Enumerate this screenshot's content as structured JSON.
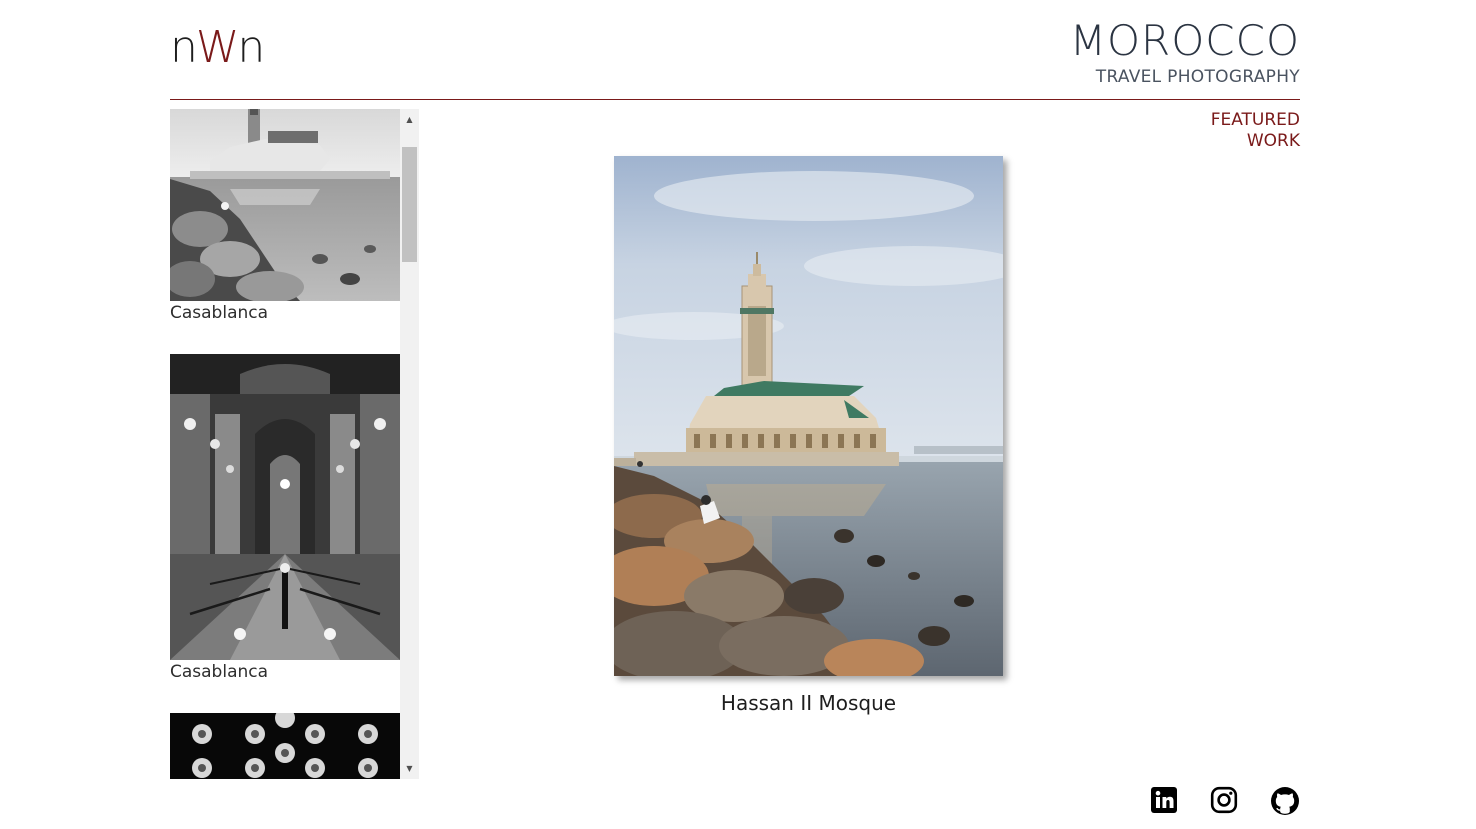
{
  "header": {
    "logo_text_left": "n",
    "logo_text_mid": "W",
    "logo_text_right": "n",
    "title": "MOROCCO",
    "subtitle": "TRAVEL PHOTOGRAPHY"
  },
  "nav": {
    "featured_line1": "FEATURED",
    "featured_line2": "WORK"
  },
  "gallery": {
    "items": [
      {
        "caption": "Casablanca"
      },
      {
        "caption": "Casablanca"
      },
      {
        "caption": ""
      }
    ]
  },
  "featured": {
    "caption": "Hassan II Mosque"
  },
  "socials": [
    "linkedin-icon",
    "instagram-icon",
    "github-icon"
  ],
  "colors": {
    "accent": "#7a1a1a",
    "title": "#2b3442",
    "scrollbar_track": "#f1f1f1",
    "scrollbar_thumb": "#c1c1c1"
  }
}
